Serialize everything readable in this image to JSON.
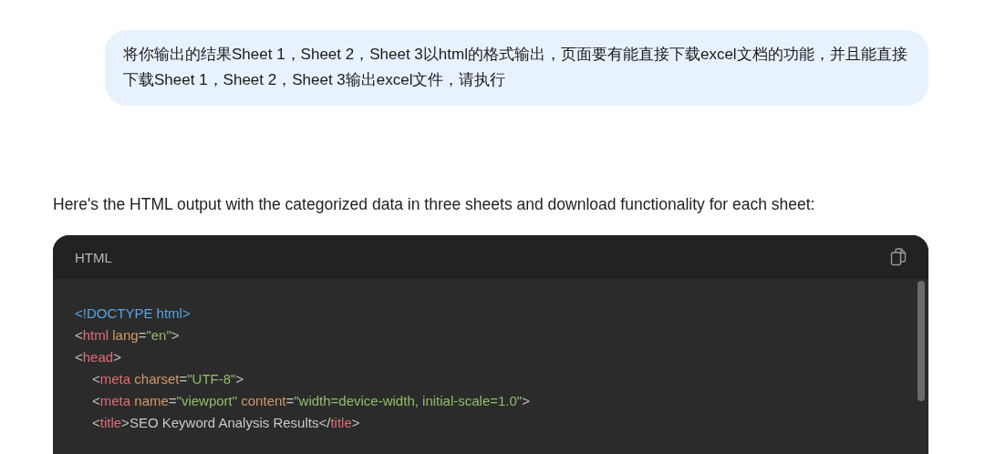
{
  "user_message": "将你输出的结果Sheet 1，Sheet 2，Sheet 3以html的格式输出，页面要有能直接下载excel文档的功能，并且能直接下载Sheet 1，Sheet 2，Sheet 3输出excel文件，请执行",
  "reply": "Here's the HTML output with the categorized data in three sheets and download functionality for each sheet:",
  "code_block": {
    "language": "HTML",
    "lines": [
      {
        "indented": false,
        "tokens": [
          {
            "kind": "doctype",
            "text": "<!DOCTYPE html>"
          }
        ]
      },
      {
        "indented": false,
        "tokens": [
          {
            "kind": "punct",
            "text": "<"
          },
          {
            "kind": "tag",
            "text": "html"
          },
          {
            "kind": "attr",
            "text": " lang"
          },
          {
            "kind": "punct",
            "text": "="
          },
          {
            "kind": "string",
            "text": "\"en\""
          },
          {
            "kind": "punct",
            "text": ">"
          }
        ]
      },
      {
        "indented": false,
        "tokens": [
          {
            "kind": "punct",
            "text": "<"
          },
          {
            "kind": "tag",
            "text": "head"
          },
          {
            "kind": "punct",
            "text": ">"
          }
        ]
      },
      {
        "indented": true,
        "tokens": [
          {
            "kind": "punct",
            "text": "<"
          },
          {
            "kind": "tag",
            "text": "meta"
          },
          {
            "kind": "attr",
            "text": " charset"
          },
          {
            "kind": "punct",
            "text": "="
          },
          {
            "kind": "string",
            "text": "\"UTF-8\""
          },
          {
            "kind": "punct",
            "text": ">"
          }
        ]
      },
      {
        "indented": true,
        "tokens": [
          {
            "kind": "punct",
            "text": "<"
          },
          {
            "kind": "tag",
            "text": "meta"
          },
          {
            "kind": "attr",
            "text": " name"
          },
          {
            "kind": "punct",
            "text": "="
          },
          {
            "kind": "string",
            "text": "\"viewport\""
          },
          {
            "kind": "attr",
            "text": " content"
          },
          {
            "kind": "punct",
            "text": "="
          },
          {
            "kind": "string",
            "text": "\"width=device-width, initial-scale=1.0\""
          },
          {
            "kind": "punct",
            "text": ">"
          }
        ]
      },
      {
        "indented": true,
        "tokens": [
          {
            "kind": "punct",
            "text": "<"
          },
          {
            "kind": "tag",
            "text": "title"
          },
          {
            "kind": "punct",
            "text": ">"
          },
          {
            "kind": "text",
            "text": "SEO Keyword Analysis Results"
          },
          {
            "kind": "punct",
            "text": "</"
          },
          {
            "kind": "tag",
            "text": "title"
          },
          {
            "kind": "punct",
            "text": ">"
          }
        ]
      }
    ]
  }
}
